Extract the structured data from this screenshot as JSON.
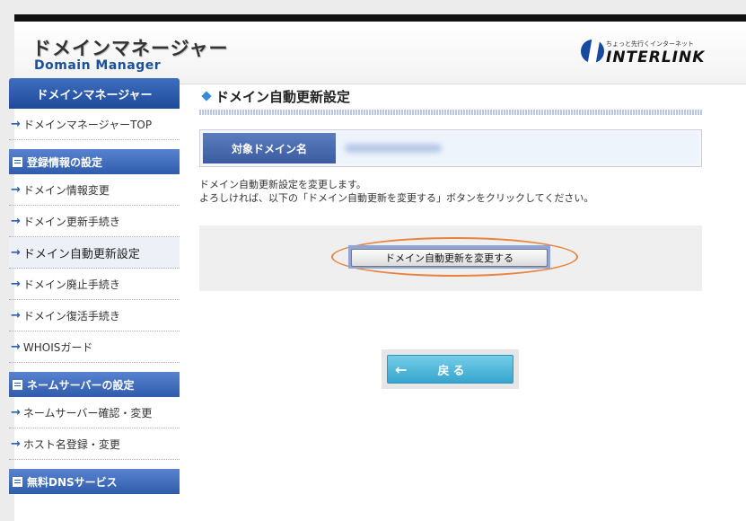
{
  "header": {
    "logo_ja": "ドメインマネージャー",
    "logo_en": "Domain Manager",
    "brand_tagline": "ちょっと先行くインターネット",
    "brand_name": "INTERLINK"
  },
  "sidebar": {
    "title": "ドメインマネージャー",
    "top_item": "ドメインマネージャーTOP",
    "sections": [
      {
        "heading": "登録情報の設定",
        "items": [
          "ドメイン情報変更",
          "ドメイン更新手続き",
          "ドメイン自動更新設定",
          "ドメイン廃止手続き",
          "ドメイン復活手続き",
          "WHOISガード"
        ]
      },
      {
        "heading": "ネームサーバーの設定",
        "items": [
          "ネームサーバー確認・変更",
          "ホスト名登録・変更"
        ]
      },
      {
        "heading": "無料DNSサービス",
        "items": []
      }
    ],
    "active_item": "ドメイン自動更新設定"
  },
  "main": {
    "title": "ドメイン自動更新設定",
    "domain_label": "対象ドメイン名",
    "description_line1": "ドメイン自動更新設定を変更します。",
    "description_line2": "よろしければ、以下の「ドメイン自動更新を変更する」ボタンをクリックしてください。",
    "change_button": "ドメイン自動更新を変更する",
    "back_button": "戻る"
  },
  "colors": {
    "accent_blue": "#2d5db0",
    "highlight_oval": "#e8843f",
    "back_button": "#36a5cc"
  },
  "icons": [
    "arrow-right-icon",
    "list-box-icon",
    "diamond-icon",
    "arrow-left-icon"
  ]
}
